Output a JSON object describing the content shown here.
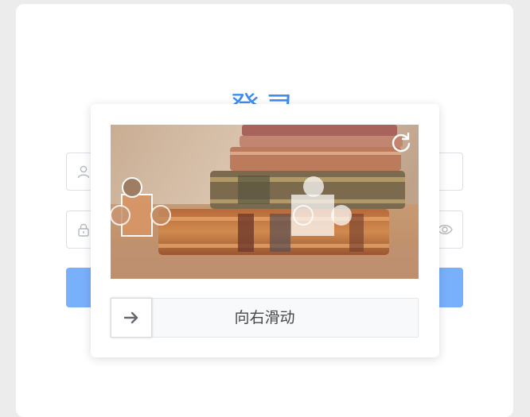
{
  "login": {
    "title": "登录"
  },
  "icons": {
    "username": "user-icon",
    "password": "lock-icon",
    "show_password": "eye-icon",
    "refresh": "refresh-icon",
    "slider": "arrow-right-icon"
  },
  "captcha": {
    "slider_text": "向右滑动"
  },
  "colors": {
    "accent": "#3f8cf0",
    "login_button": "#79b0fc",
    "page_background": "#ececec"
  }
}
